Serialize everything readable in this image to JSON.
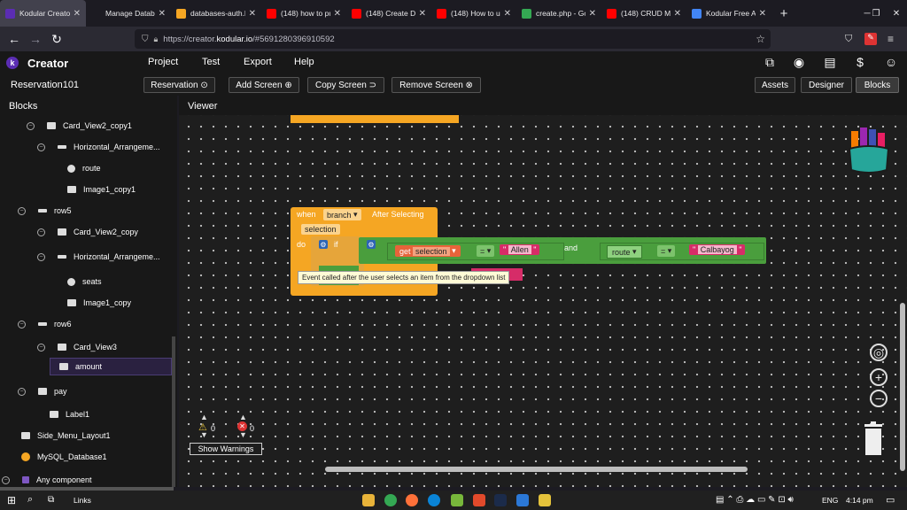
{
  "browser": {
    "tabs": [
      {
        "label": "Kodular Creator",
        "active": true,
        "favicon_color": "#5b2db3"
      },
      {
        "label": "Manage Databases",
        "active": false,
        "favicon_color": ""
      },
      {
        "label": "databases-auth.l",
        "active": false,
        "favicon_color": "#f5a623"
      },
      {
        "label": "(148) how to put",
        "active": false,
        "favicon_color": "#ff0000"
      },
      {
        "label": "(148) Create Dy",
        "active": false,
        "favicon_color": "#ff0000"
      },
      {
        "label": "(148) How to use",
        "active": false,
        "favicon_color": "#ff0000"
      },
      {
        "label": "create.php - Goo",
        "active": false,
        "favicon_color": "#34a853"
      },
      {
        "label": "(148) CRUD MYS",
        "active": false,
        "favicon_color": "#ff0000"
      },
      {
        "label": "Kodular Free AIA",
        "active": false,
        "favicon_color": "#4285f4"
      }
    ],
    "url_prefix": "https://creator.",
    "url_domain": "kodular.io",
    "url_suffix": "/#5691280396910592"
  },
  "app": {
    "name": "Creator",
    "logo_letter": "k",
    "menu": [
      "Project",
      "Test",
      "Export",
      "Help"
    ]
  },
  "screenbar": {
    "project": "Reservation101",
    "screen_select": "Reservation ⊙",
    "add_screen": "Add Screen ⊕",
    "copy_screen": "Copy Screen ⊃",
    "remove_screen": "Remove Screen ⊗",
    "assets": "Assets",
    "designer": "Designer",
    "blocks": "Blocks"
  },
  "panels": {
    "blocks": "Blocks",
    "viewer": "Viewer"
  },
  "tree": [
    {
      "label": "Card_View2_copy1",
      "collapse": true
    },
    {
      "label": "Horizontal_Arrangeme...",
      "collapse": true
    },
    {
      "label": "route",
      "collapse": false
    },
    {
      "label": "Image1_copy1",
      "collapse": false
    },
    {
      "label": "row5",
      "collapse": true
    },
    {
      "label": "Card_View2_copy",
      "collapse": true
    },
    {
      "label": "Horizontal_Arrangeme...",
      "collapse": true
    },
    {
      "label": "seats",
      "collapse": false
    },
    {
      "label": "Image1_copy",
      "collapse": false
    },
    {
      "label": "row6",
      "collapse": true
    },
    {
      "label": "Card_View3",
      "collapse": true
    },
    {
      "label": "amount",
      "collapse": false
    },
    {
      "label": "pay",
      "collapse": true
    },
    {
      "label": "Label1",
      "collapse": false
    },
    {
      "label": "Side_Menu_Layout1",
      "collapse": false
    },
    {
      "label": "MySQL_Database1",
      "collapse": false
    },
    {
      "label": "Any component",
      "collapse": true
    }
  ],
  "blocks": {
    "when": "when",
    "component": "branch",
    "event": "After Selecting",
    "param": "selection",
    "do": "do",
    "if": "if",
    "get": "get",
    "get_var": "selection",
    "eq1": "=",
    "str1": "Allen",
    "and": "and",
    "route": "route",
    "eq2": "=",
    "str2": "Calbayog",
    "tooltip": "Event called after the user selects an item from the dropdown list"
  },
  "warnings": {
    "warn_count": "0",
    "err_count": "0",
    "show_label": "Show Warnings"
  },
  "taskbar": {
    "links": "Links",
    "lang": "ENG",
    "time": "4:14 pm"
  }
}
